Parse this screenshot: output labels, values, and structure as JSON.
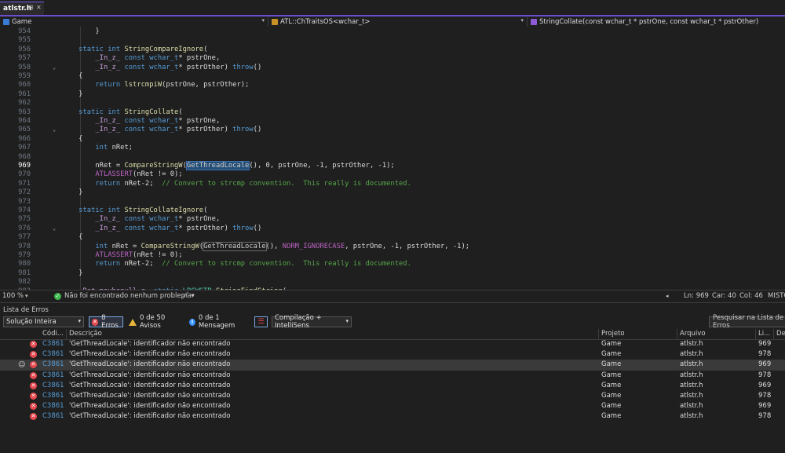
{
  "tab": {
    "name": "atlstr.h",
    "pin_icon": "pin-icon",
    "close_icon": "close-icon"
  },
  "nav": {
    "project": "Game",
    "scope": "ATL::ChTraitsOS<wchar_t>",
    "member": "StringCollate(const wchar_t * pstrOne, const wchar_t * pstrOther)"
  },
  "editor": {
    "current_line": 969,
    "lines": [
      {
        "n": 954,
        "fold": false,
        "t": [
          [
            "pl",
            "        }"
          ]
        ]
      },
      {
        "n": 955,
        "fold": false,
        "t": []
      },
      {
        "n": 956,
        "fold": false,
        "t": [
          [
            "kw",
            "    static "
          ],
          [
            "kw",
            "int "
          ],
          [
            "fn",
            "StringCompareIgnore"
          ],
          [
            "pl",
            "("
          ]
        ]
      },
      {
        "n": 957,
        "fold": false,
        "t": [
          [
            "mc",
            "        _In_z_ "
          ],
          [
            "kw",
            "const "
          ],
          [
            "kw",
            "wchar_t"
          ],
          [
            "pl",
            "* pstrOne,"
          ]
        ]
      },
      {
        "n": 958,
        "fold": true,
        "t": [
          [
            "mc",
            "        _In_z_ "
          ],
          [
            "kw",
            "const "
          ],
          [
            "kw",
            "wchar_t"
          ],
          [
            "pl",
            "* pstrOther) "
          ],
          [
            "kw",
            "throw"
          ],
          [
            "pl",
            "()"
          ]
        ]
      },
      {
        "n": 959,
        "fold": false,
        "t": [
          [
            "pl",
            "    {"
          ]
        ]
      },
      {
        "n": 960,
        "fold": false,
        "t": [
          [
            "kw",
            "        return "
          ],
          [
            "fn",
            "lstrcmpiW"
          ],
          [
            "pl",
            "(pstrOne, pstrOther);"
          ]
        ]
      },
      {
        "n": 961,
        "fold": false,
        "t": [
          [
            "pl",
            "    }"
          ]
        ]
      },
      {
        "n": 962,
        "fold": false,
        "t": []
      },
      {
        "n": 963,
        "fold": false,
        "t": [
          [
            "kw",
            "    static "
          ],
          [
            "kw",
            "int "
          ],
          [
            "fn",
            "StringCollate"
          ],
          [
            "pl",
            "("
          ]
        ]
      },
      {
        "n": 964,
        "fold": false,
        "t": [
          [
            "mc",
            "        _In_z_ "
          ],
          [
            "kw",
            "const "
          ],
          [
            "kw",
            "wchar_t"
          ],
          [
            "pl",
            "* pstrOne,"
          ]
        ]
      },
      {
        "n": 965,
        "fold": true,
        "t": [
          [
            "mc",
            "        _In_z_ "
          ],
          [
            "kw",
            "const "
          ],
          [
            "kw",
            "wchar_t"
          ],
          [
            "pl",
            "* pstrOther) "
          ],
          [
            "kw",
            "throw"
          ],
          [
            "pl",
            "()"
          ]
        ]
      },
      {
        "n": 966,
        "fold": false,
        "t": [
          [
            "pl",
            "    {"
          ]
        ]
      },
      {
        "n": 967,
        "fold": false,
        "t": [
          [
            "kw",
            "        int "
          ],
          [
            "pl",
            "nRet;"
          ]
        ]
      },
      {
        "n": 968,
        "fold": false,
        "t": []
      },
      {
        "n": 969,
        "fold": false,
        "t": [
          [
            "pl",
            "        nRet = "
          ],
          [
            "fn",
            "CompareStringW"
          ],
          [
            "pl",
            "("
          ],
          [
            "hl",
            "GetThreadLocale"
          ],
          [
            "pl",
            "(), 0, pstrOne, -1, pstrOther, -1);"
          ]
        ]
      },
      {
        "n": 970,
        "fold": false,
        "t": [
          [
            "mac",
            "        ATLASSERT"
          ],
          [
            "pl",
            "(nRet != 0);"
          ]
        ]
      },
      {
        "n": 971,
        "fold": false,
        "t": [
          [
            "kw",
            "        return "
          ],
          [
            "pl",
            "nRet-2;  "
          ],
          [
            "cm",
            "// Convert to strcmp convention.  This really is documented."
          ]
        ]
      },
      {
        "n": 972,
        "fold": false,
        "t": [
          [
            "pl",
            "    }"
          ]
        ]
      },
      {
        "n": 973,
        "fold": false,
        "t": []
      },
      {
        "n": 974,
        "fold": false,
        "t": [
          [
            "kw",
            "    static "
          ],
          [
            "kw",
            "int "
          ],
          [
            "fn",
            "StringCollateIgnore"
          ],
          [
            "pl",
            "("
          ]
        ]
      },
      {
        "n": 975,
        "fold": false,
        "t": [
          [
            "mc",
            "        _In_z_ "
          ],
          [
            "kw",
            "const "
          ],
          [
            "kw",
            "wchar_t"
          ],
          [
            "pl",
            "* pstrOne,"
          ]
        ]
      },
      {
        "n": 976,
        "fold": true,
        "t": [
          [
            "mc",
            "        _In_z_ "
          ],
          [
            "kw",
            "const "
          ],
          [
            "kw",
            "wchar_t"
          ],
          [
            "pl",
            "* pstrOther) "
          ],
          [
            "kw",
            "throw"
          ],
          [
            "pl",
            "()"
          ]
        ]
      },
      {
        "n": 977,
        "fold": false,
        "t": [
          [
            "pl",
            "    {"
          ]
        ]
      },
      {
        "n": 978,
        "fold": false,
        "t": [
          [
            "kw",
            "        int "
          ],
          [
            "pl",
            "nRet = "
          ],
          [
            "fn",
            "CompareStringW"
          ],
          [
            "pl",
            "("
          ],
          [
            "hl2",
            "GetThreadLocale"
          ],
          [
            "pl",
            "(), "
          ],
          [
            "mac",
            "NORM_IGNORECASE"
          ],
          [
            "pl",
            ", pstrOne, -1, pstrOther, -1);"
          ]
        ]
      },
      {
        "n": 979,
        "fold": false,
        "t": [
          [
            "mac",
            "        ATLASSERT"
          ],
          [
            "pl",
            "(nRet != 0);"
          ]
        ]
      },
      {
        "n": 980,
        "fold": false,
        "t": [
          [
            "kw",
            "        return "
          ],
          [
            "pl",
            "nRet-2;  "
          ],
          [
            "cm",
            "// Convert to strcmp convention.  This really is documented."
          ]
        ]
      },
      {
        "n": 981,
        "fold": false,
        "t": [
          [
            "pl",
            "    }"
          ]
        ]
      },
      {
        "n": 982,
        "fold": false,
        "t": []
      },
      {
        "n": 983,
        "fold": false,
        "t": [
          [
            "mc",
            "    _Ret_maybenull_z_ "
          ],
          [
            "kw",
            "static "
          ],
          [
            "ty",
            "LPCWSTR "
          ],
          [
            "fn",
            "StringFindString"
          ],
          [
            "pl",
            "("
          ]
        ]
      }
    ]
  },
  "status": {
    "zoom": "100 %",
    "problems": "Não foi encontrado nenhum problema",
    "line": "Ln: 969",
    "col": "Car: 40",
    "colnum": "Col: 46",
    "encoding": "MISTO"
  },
  "errorlist": {
    "title": "Lista de Erros",
    "scope": "Solução Inteira",
    "errors": "8 Erros",
    "warnings": "0 de 50 Avisos",
    "messages": "0 de 1 Mensagem",
    "build": "Compilação + IntelliSens",
    "search": "Pesquisar na Lista de Erros",
    "headers": {
      "code": "Códi...",
      "desc": "Descrição",
      "project": "Projeto",
      "file": "Arquivo",
      "line": "Li...",
      "extra": "Def"
    },
    "rows": [
      {
        "code": "C3861",
        "desc": "'GetThreadLocale': identificador não encontrado",
        "project": "Game",
        "file": "atlstr.h",
        "line": "969",
        "selected": false
      },
      {
        "code": "C3861",
        "desc": "'GetThreadLocale': identificador não encontrado",
        "project": "Game",
        "file": "atlstr.h",
        "line": "978",
        "selected": false
      },
      {
        "code": "C3861",
        "desc": "'GetThreadLocale': identificador não encontrado",
        "project": "Game",
        "file": "atlstr.h",
        "line": "969",
        "selected": true
      },
      {
        "code": "C3861",
        "desc": "'GetThreadLocale': identificador não encontrado",
        "project": "Game",
        "file": "atlstr.h",
        "line": "978",
        "selected": false
      },
      {
        "code": "C3861",
        "desc": "'GetThreadLocale': identificador não encontrado",
        "project": "Game",
        "file": "atlstr.h",
        "line": "969",
        "selected": false
      },
      {
        "code": "C3861",
        "desc": "'GetThreadLocale': identificador não encontrado",
        "project": "Game",
        "file": "atlstr.h",
        "line": "978",
        "selected": false
      },
      {
        "code": "C3861",
        "desc": "'GetThreadLocale': identificador não encontrado",
        "project": "Game",
        "file": "atlstr.h",
        "line": "969",
        "selected": false
      },
      {
        "code": "C3861",
        "desc": "'GetThreadLocale': identificador não encontrado",
        "project": "Game",
        "file": "atlstr.h",
        "line": "978",
        "selected": false
      }
    ]
  },
  "colors": {
    "accent": "#6c4fd1",
    "error": "#e5484d",
    "warning": "#e8b53a",
    "info": "#3794ff"
  }
}
